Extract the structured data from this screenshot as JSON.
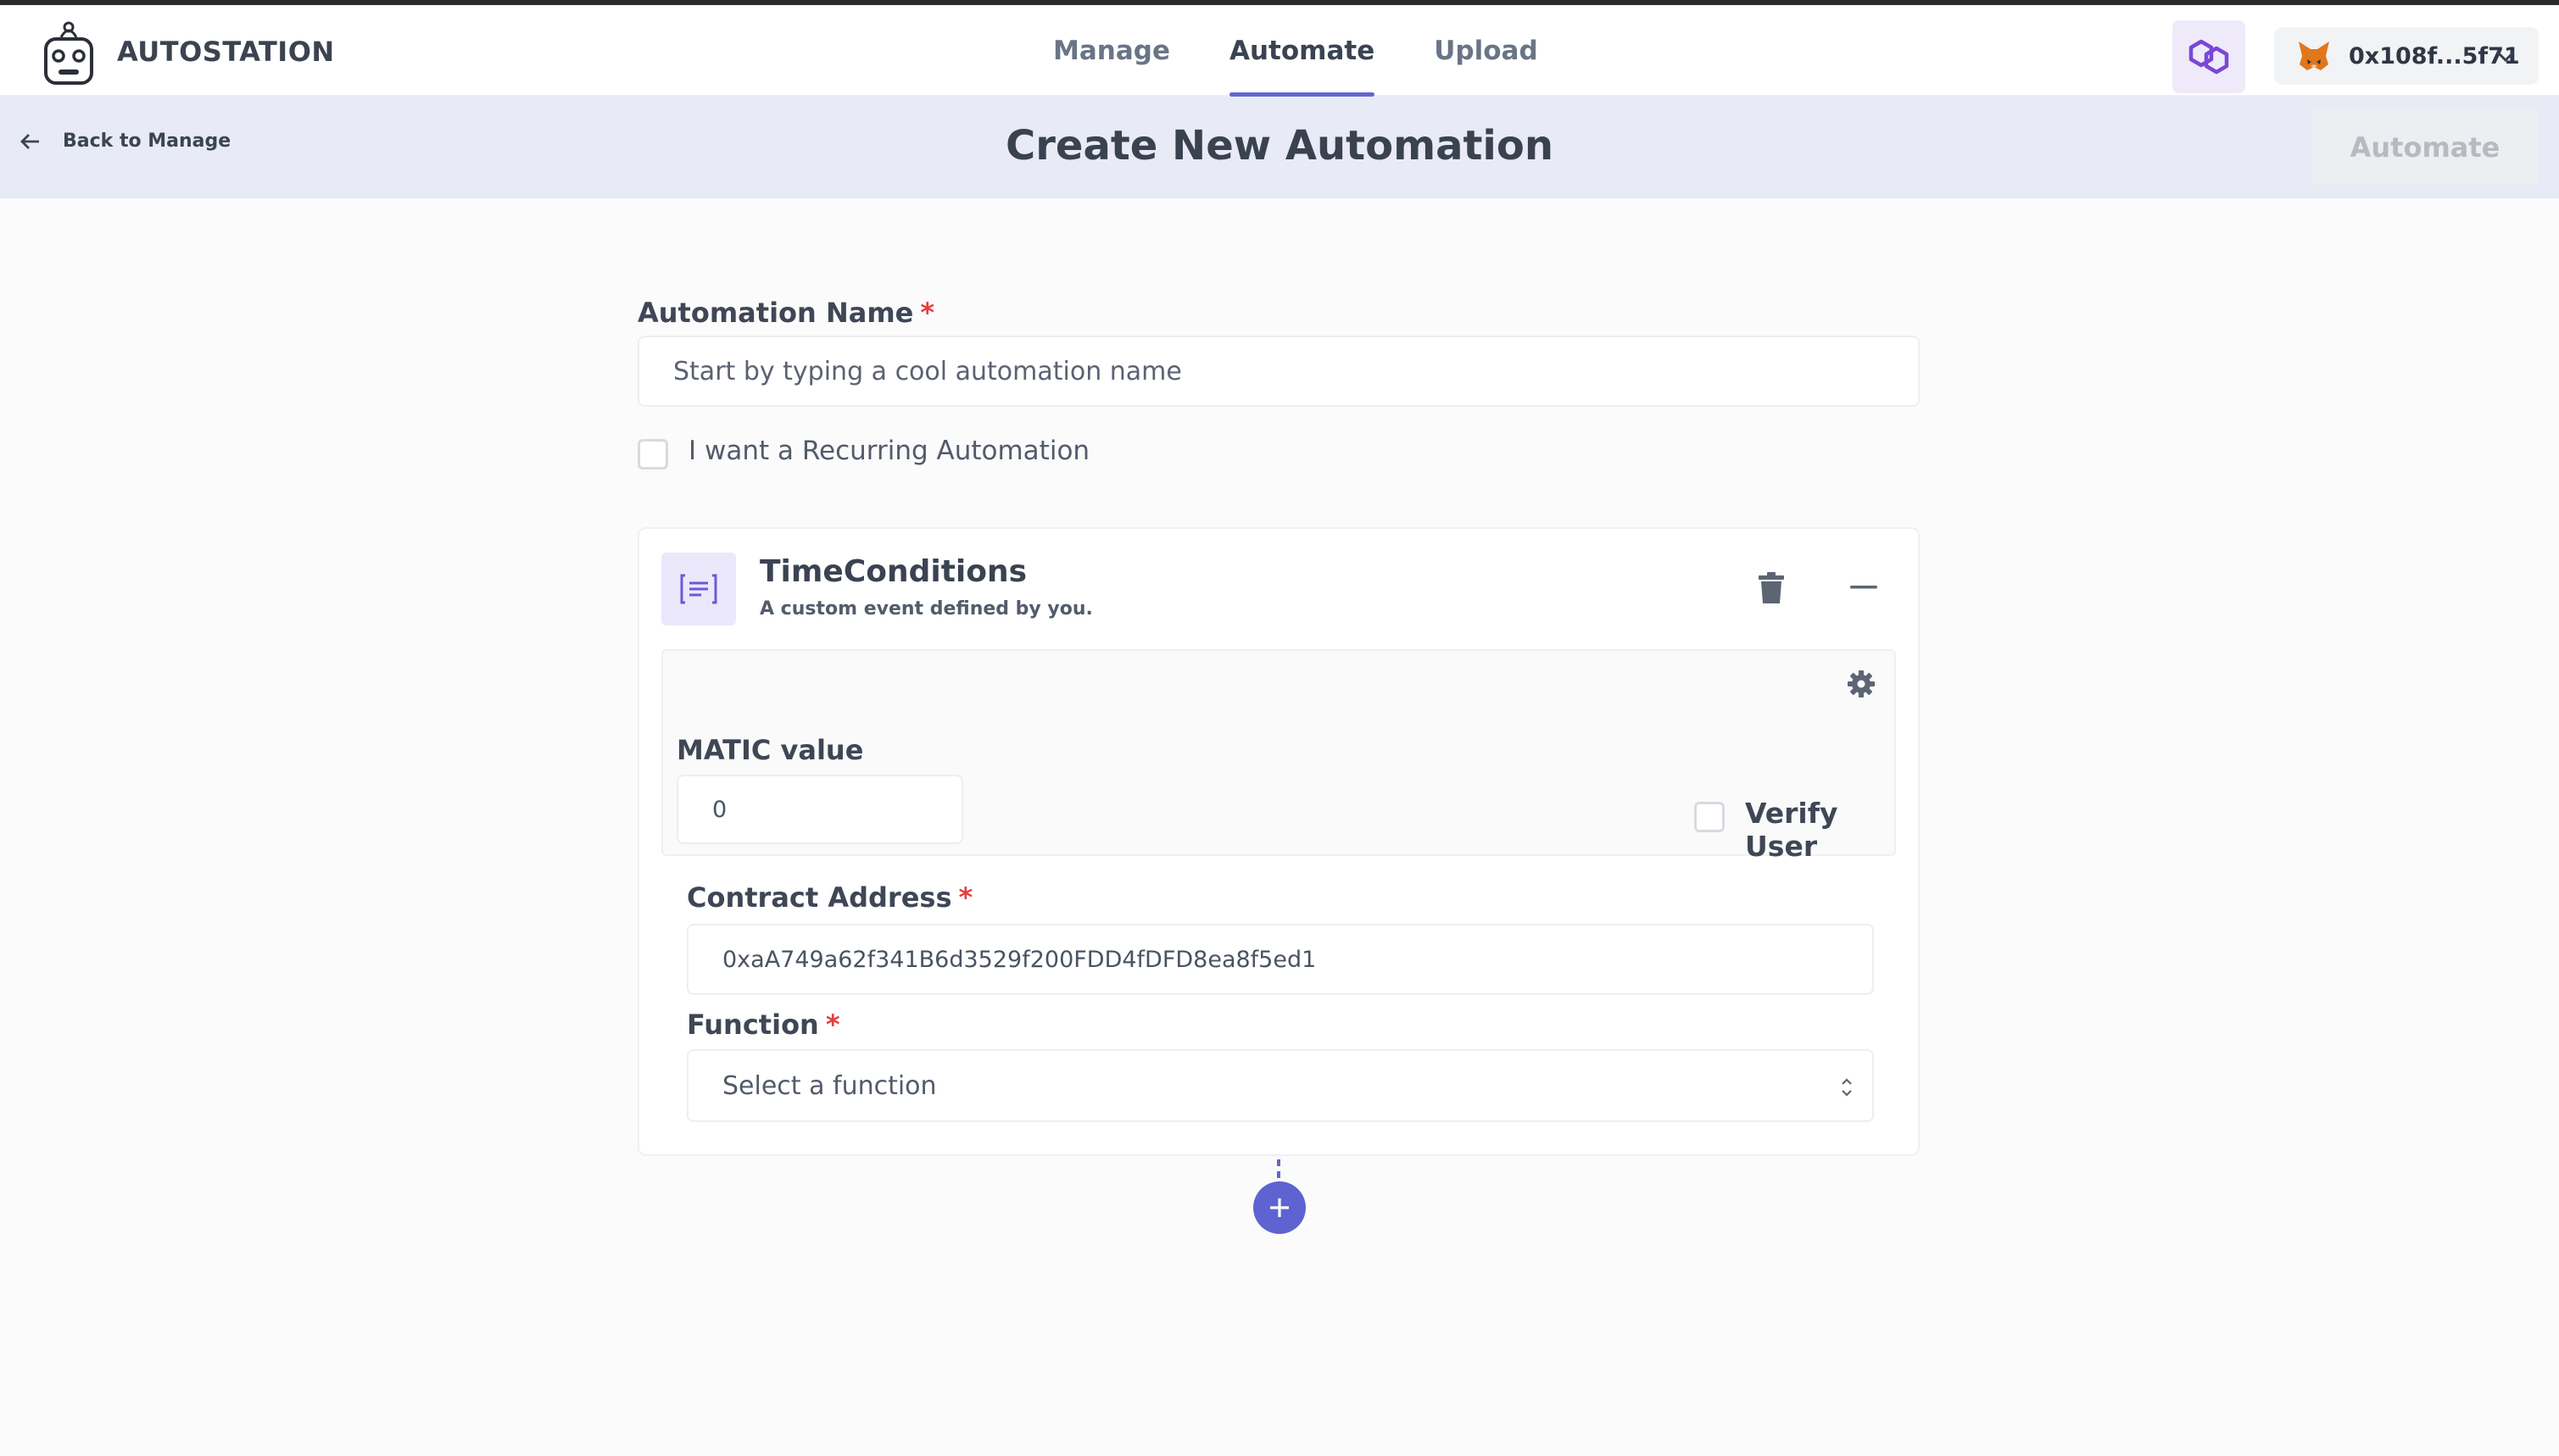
{
  "header": {
    "brand": "AUTOSTATION",
    "nav": [
      {
        "label": "Manage",
        "active": false
      },
      {
        "label": "Automate",
        "active": true
      },
      {
        "label": "Upload",
        "active": false
      }
    ],
    "wallet_address": "0x108f...5f71",
    "icons": {
      "logo": "robot-logo-icon",
      "network": "polygon-icon",
      "wallet": "metamask-fox-icon",
      "wallet_menu": "chevron-down-icon"
    }
  },
  "subheader": {
    "back_label": "Back to Manage",
    "title": "Create New Automation",
    "automate_label": "Automate"
  },
  "form": {
    "name_label": "Automation Name",
    "required_mark": "*",
    "name_placeholder": "Start by typing a cool automation name",
    "recurring_label": "I want a Recurring Automation",
    "recurring_checked": false
  },
  "card": {
    "title": "TimeConditions",
    "subtitle": "A custom event defined by you.",
    "matic_label": "MATIC value",
    "matic_value": "0",
    "verify_label": "Verify User",
    "verify_checked": false,
    "contract_label": "Contract Address",
    "contract_value": "0xaA749a62f341B6d3529f200FDD4fDFD8ea8f5ed1",
    "function_label": "Function",
    "function_placeholder": "Select a function"
  },
  "colors": {
    "accent": "#6366d1",
    "subheader_bg": "#e8eaf6",
    "required": "#e53e3e"
  }
}
